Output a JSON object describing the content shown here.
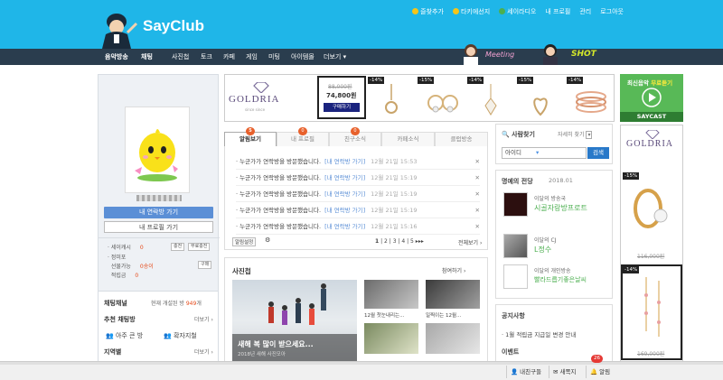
{
  "header": {
    "logo_text": "SayClub",
    "top_links": [
      {
        "label": "즐찾추가",
        "icon": "star-icon",
        "color": "#f5c518"
      },
      {
        "label": "타키에선지",
        "icon": "smile-icon",
        "color": "#f5c518"
      },
      {
        "label": "세이라디오",
        "icon": "radio-icon",
        "color": "#4caf50"
      },
      {
        "label": "내 프로필",
        "icon": "",
        "color": ""
      },
      {
        "label": "관리",
        "icon": "",
        "color": ""
      },
      {
        "label": "로그아웃",
        "icon": "",
        "color": ""
      }
    ]
  },
  "nav": {
    "items": [
      "음악방송",
      "채팅",
      "사진첩",
      "토크",
      "카페",
      "게임",
      "미팅",
      "아이템몰",
      "더보기"
    ],
    "meeting_label": "Meeting",
    "shot_label": "SHOT"
  },
  "profile": {
    "btn_chatroom": "내 연락방 가기",
    "btn_profile": "내 프로필 가기",
    "stats": [
      {
        "label": "세이캐시",
        "value": "0"
      },
      {
        "label": "정미포",
        "value": ""
      },
      {
        "label": "선물가능",
        "value": "0송이"
      },
      {
        "label": "적립금",
        "value": "0"
      }
    ],
    "btn_charge": "충전",
    "btn_free_charge": "무료충전",
    "btn_buy": "구매"
  },
  "chat_channel": {
    "title": "채팅채널",
    "current_label": "현재 개설된 방",
    "count": "949",
    "unit": "개",
    "recommend": "추천 채팅방",
    "more": "더보기",
    "rooms": [
      "아주 큰 방",
      "확자지철"
    ],
    "region": "지역별",
    "region_more": "더보기"
  },
  "ad": {
    "brand": "GOLDRIA",
    "brand_sub": "since since",
    "old_price": "88,000원",
    "price": "74,800원",
    "buy_btn": "구매하기",
    "discounts": [
      "-14%",
      "-15%",
      "-14%",
      "-15%",
      "-14%"
    ],
    "colors": {
      "gold": "#c9a46a",
      "pink": "#f4b8c4"
    }
  },
  "saycast": {
    "title": "최신음악",
    "title2": "무료듣기",
    "brand": "SAYCAST"
  },
  "right_ad": {
    "brand": "GOLDRIA",
    "discount1": "-15%",
    "price1": "116,000원",
    "discount2": "-14%",
    "price2": "169,000원"
  },
  "tabs": [
    {
      "label": "알림보기",
      "badge": "5",
      "active": true
    },
    {
      "label": "내 프로필",
      "badge": "0",
      "active": false
    },
    {
      "label": "친구소식",
      "badge": "0",
      "active": false
    },
    {
      "label": "카페소식",
      "badge": "",
      "active": false
    },
    {
      "label": "클럽방송",
      "badge": "",
      "active": false
    }
  ],
  "alarms": [
    {
      "text": "누군가가 연락방을 방문했습니다.",
      "link": "[내 연락방 가기]",
      "time": "12월 21일 15:53"
    },
    {
      "text": "누군가가 연락방을 방문했습니다.",
      "link": "[내 연락방 가기]",
      "time": "12월 21일 15:19"
    },
    {
      "text": "누군가가 연락방을 방문했습니다.",
      "link": "[내 연락방 가기]",
      "time": "12월 21일 15:19"
    },
    {
      "text": "누군가가 연락방을 방문했습니다.",
      "link": "[내 연락방 가기]",
      "time": "12월 21일 15:19"
    },
    {
      "text": "누군가가 연락방을 방문했습니다.",
      "link": "[내 연락방 가기]",
      "time": "12월 21일 15:16"
    }
  ],
  "alarm_footer": {
    "settings_btn": "알림설정",
    "pages": [
      "1",
      "2",
      "3",
      "4",
      "5"
    ],
    "view_all": "전체보기"
  },
  "photos": {
    "title": "사진첩",
    "more": "참여하기",
    "main_caption": "새해 복 많이 받으세요...",
    "main_sub": "2018년 새해 사진모아",
    "thumbs": [
      "12월 첫눈내리는...",
      "일찍이는 12월...",
      "",
      ""
    ]
  },
  "people_search": {
    "title": "사람찾기",
    "detail": "자세히 찾기",
    "select_value": "아이디",
    "btn": "검색"
  },
  "hall_of_fame": {
    "title": "명예의 전당",
    "date": "2018.01",
    "items": [
      {
        "sub": "이달의 방송국",
        "title": "시골자랑방프로트"
      },
      {
        "sub": "이달의 CJ",
        "title": "L정수"
      },
      {
        "sub": "이달의 개인방송",
        "title": "빨라드릅기좋은날씨"
      }
    ]
  },
  "notice": {
    "title": "공지사항",
    "item": "1월 적립금 지급일 변경 안내",
    "event": "이벤트"
  },
  "bottom_bar": {
    "friends": "내친구들",
    "messages": "새쪽지",
    "alarm": "알림",
    "alarm_count": "26"
  }
}
